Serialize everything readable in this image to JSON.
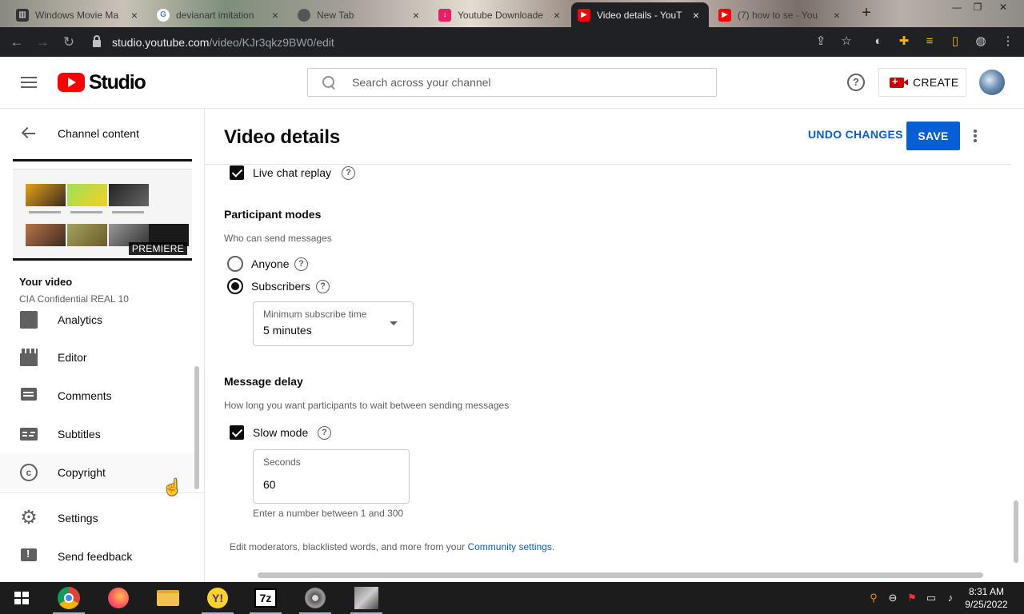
{
  "browser": {
    "tabs": [
      {
        "title": "Windows Movie Ma",
        "icon": "page-icon",
        "active": false
      },
      {
        "title": "devianart imitation",
        "icon": "google-icon",
        "active": false
      },
      {
        "title": "New Tab",
        "icon": "shield-icon",
        "active": false
      },
      {
        "title": "Youtube Downloade",
        "icon": "download-icon",
        "active": false
      },
      {
        "title": "Video details - YouT",
        "icon": "youtube-icon",
        "active": true
      },
      {
        "title": "(7) how to se - You",
        "icon": "youtube-icon",
        "active": false
      }
    ],
    "new_tab_symbol": "+",
    "url_domain": "studio.youtube.com",
    "url_path": "/video/KJr3qkz9BW0/edit"
  },
  "header": {
    "logo_text": "Studio",
    "search_placeholder": "Search across your channel",
    "create_label": "CREATE"
  },
  "sidebar": {
    "back_label": "Channel content",
    "thumbnail_badge": "PREMIERE",
    "your_video_label": "Your video",
    "video_title": "CIA Confidential REAL 10",
    "items": [
      {
        "label": "Analytics",
        "icon": "analytics-icon"
      },
      {
        "label": "Editor",
        "icon": "film-icon"
      },
      {
        "label": "Comments",
        "icon": "comment-icon"
      },
      {
        "label": "Subtitles",
        "icon": "subtitles-icon"
      },
      {
        "label": "Copyright",
        "icon": "copyright-icon"
      },
      {
        "label": "Settings",
        "icon": "gear-icon"
      },
      {
        "label": "Send feedback",
        "icon": "feedback-icon"
      }
    ]
  },
  "main": {
    "title": "Video details",
    "undo_label": "UNDO CHANGES",
    "save_label": "SAVE",
    "live_chat_replay_label": "Live chat replay",
    "live_chat_replay_checked": true,
    "participant_modes": {
      "heading": "Participant modes",
      "subheading": "Who can send messages",
      "options": [
        {
          "label": "Anyone",
          "selected": false
        },
        {
          "label": "Subscribers",
          "selected": true
        }
      ],
      "min_subscribe_label": "Minimum subscribe time",
      "min_subscribe_value": "5 minutes"
    },
    "message_delay": {
      "heading": "Message delay",
      "subheading": "How long you want participants to wait between sending messages",
      "slow_mode_label": "Slow mode",
      "slow_mode_checked": true,
      "seconds_label": "Seconds",
      "seconds_value": "60",
      "seconds_hint": "Enter a number between 1 and 300"
    },
    "footer_text": "Edit moderators, blacklisted words, and more from your",
    "footer_link": "Community settings",
    "footer_end": "."
  },
  "taskbar": {
    "time": "8:31 AM",
    "date": "9/25/2022",
    "apps": [
      "chrome-icon",
      "firefox-icon",
      "folder-icon",
      "yahoo-messenger-icon",
      "7zip-icon",
      "movie-maker-icon",
      "app-icon"
    ]
  },
  "colors": {
    "accent": "#065fd4",
    "brand_red": "#ff0000",
    "text_primary": "#0d0d0d",
    "text_secondary": "#606060"
  }
}
